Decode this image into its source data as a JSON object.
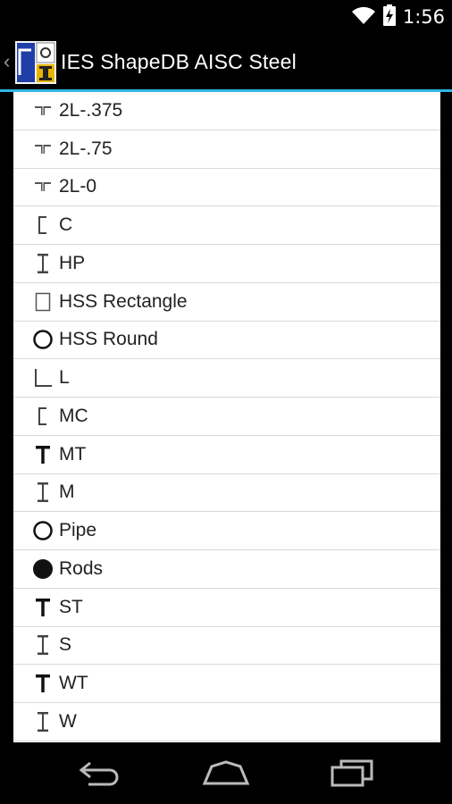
{
  "status_bar": {
    "time": "1:56",
    "icons": [
      "wifi-icon",
      "battery-charging-icon"
    ]
  },
  "action_bar": {
    "back_glyph": "‹",
    "title": "IES ShapeDB AISC Steel"
  },
  "shapes": [
    {
      "label": "2L-.375",
      "icon": "double-angle-icon"
    },
    {
      "label": "2L-.75",
      "icon": "double-angle-icon"
    },
    {
      "label": "2L-0",
      "icon": "double-angle-icon"
    },
    {
      "label": "C",
      "icon": "channel-icon"
    },
    {
      "label": "HP",
      "icon": "i-beam-icon"
    },
    {
      "label": "HSS Rectangle",
      "icon": "rectangle-tube-icon"
    },
    {
      "label": "HSS Round",
      "icon": "round-tube-icon"
    },
    {
      "label": "L",
      "icon": "angle-icon"
    },
    {
      "label": "MC",
      "icon": "channel-icon"
    },
    {
      "label": "MT",
      "icon": "tee-icon"
    },
    {
      "label": "M",
      "icon": "i-beam-icon"
    },
    {
      "label": "Pipe",
      "icon": "pipe-icon"
    },
    {
      "label": "Rods",
      "icon": "rod-icon"
    },
    {
      "label": "ST",
      "icon": "tee-icon"
    },
    {
      "label": "S",
      "icon": "i-beam-icon"
    },
    {
      "label": "WT",
      "icon": "tee-icon"
    },
    {
      "label": "W",
      "icon": "i-beam-icon"
    }
  ],
  "nav_bar": {
    "buttons": [
      "back-icon",
      "home-icon",
      "recent-apps-icon"
    ]
  },
  "colors": {
    "accent": "#33b5e5",
    "list_bg": "#ffffff",
    "text": "#222222"
  }
}
